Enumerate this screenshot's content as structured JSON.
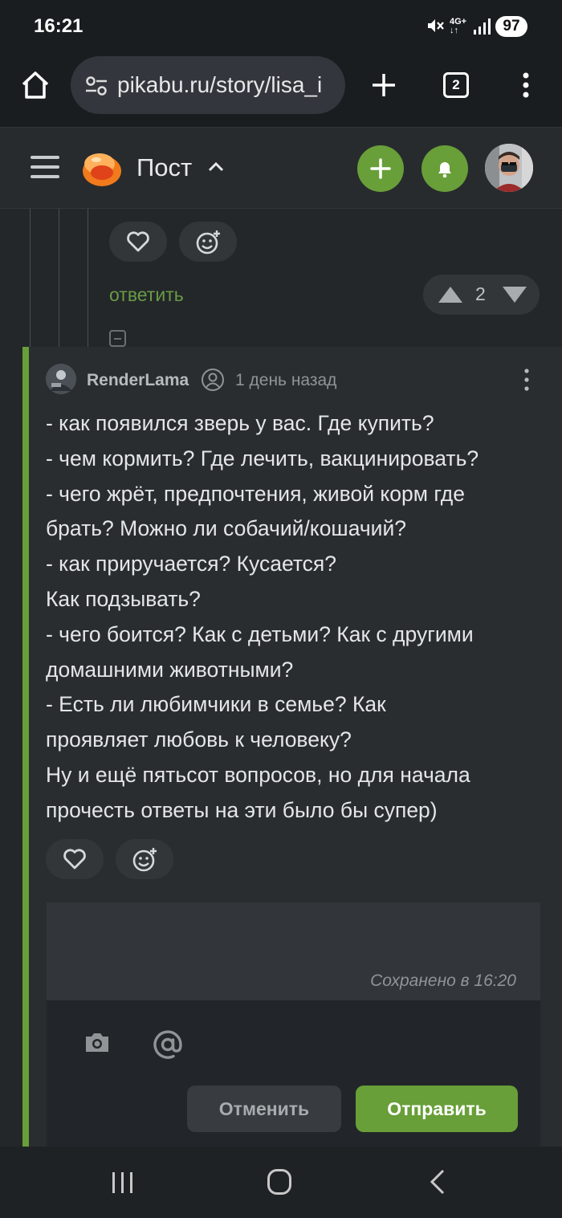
{
  "status_bar": {
    "time": "16:21",
    "network": "4G+",
    "battery": "97"
  },
  "browser": {
    "url": "pikabu.ru/story/lisa_i",
    "tab_count": "2"
  },
  "header": {
    "title": "Пост"
  },
  "prev_comment": {
    "reply_label": "ответить",
    "rating": "2"
  },
  "comment": {
    "author": "RenderLama",
    "time": "1 день назад",
    "lines": [
      "- как появился зверь у вас. Где купить?",
      "- чем кормить? Где лечить, вакцинировать?",
      "- чего жрёт, предпочтения, живой корм где",
      "брать? Можно ли собачий/кошачий?",
      "- как приручается? Кусается?",
      "Как подзывать?",
      "- чего боится? Как с детьми? Как с другими",
      "домашними животными?",
      "- Есть ли любимчики в семье? Как",
      "проявляет любовь к человеку?",
      "Ну и ещё пятьсот вопросов, но для начала",
      "прочесть ответы на эти было бы супер)"
    ]
  },
  "editor": {
    "saved_status": "Сохранено в 16:20",
    "cancel_label": "Отменить",
    "send_label": "Отправить"
  },
  "colors": {
    "accent_green": "#689f38",
    "background": "#23272a",
    "browser_bar": "#1a1d1f"
  }
}
